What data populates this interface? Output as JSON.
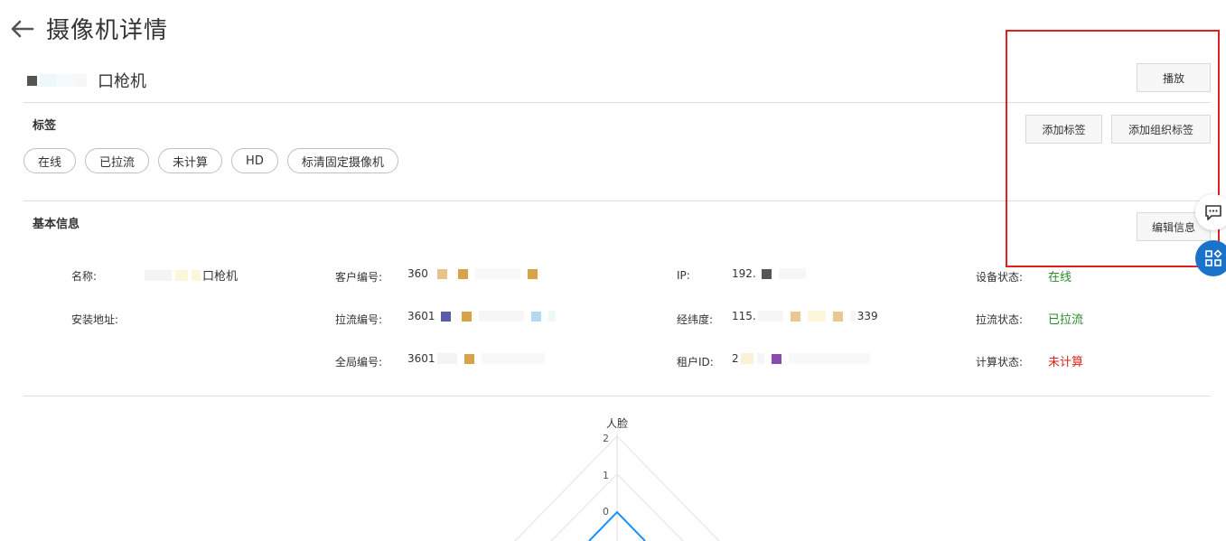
{
  "header": {
    "title": "摄像机详情"
  },
  "camera": {
    "name_suffix": "口枪机"
  },
  "tags_section": {
    "label": "标签",
    "tags": [
      "在线",
      "已拉流",
      "未计算",
      "HD",
      "标清固定摄像机"
    ],
    "add_tag_button": "添加标签",
    "add_org_tag_button": "添加组织标签"
  },
  "toolbar": {
    "play_button": "播放"
  },
  "basic_info": {
    "label": "基本信息",
    "edit_button": "编辑信息",
    "name_label": "名称:",
    "name_value": "口枪机",
    "address_label": "安装地址:",
    "customer_no_label": "客户编号:",
    "customer_no_value": "360",
    "stream_no_label": "拉流编号:",
    "stream_no_value": "3601",
    "global_no_label": "全局编号:",
    "global_no_value": "3601",
    "ip_label": "IP:",
    "ip_value": "192.",
    "lnglat_label": "经纬度:",
    "lnglat_value_start": "115.",
    "lnglat_value_end": "339",
    "tenant_label": "租户ID:",
    "tenant_value": "2",
    "device_status_label": "设备状态:",
    "device_status_value": "在线",
    "stream_status_label": "拉流状态:",
    "stream_status_value": "已拉流",
    "compute_status_label": "计算状态:",
    "compute_status_value": "未计算"
  },
  "radar": {
    "axis_label": "人脸",
    "ticks": [
      "2",
      "1",
      "0"
    ]
  },
  "colors": {
    "status_green": "#2a8a2a",
    "status_red": "#d9261c",
    "annotation_box": "#e02020",
    "radar_line": "#1890ff",
    "float_app_bg": "#1a73c8"
  },
  "icons": [
    "back-arrow-icon",
    "chat-icon",
    "apps-icon"
  ]
}
